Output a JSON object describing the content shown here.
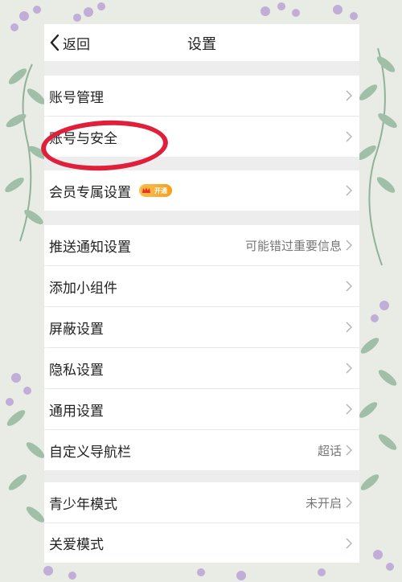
{
  "nav": {
    "back_label": "返回",
    "title": "设置"
  },
  "rows": [
    {
      "label": "账号管理",
      "value": ""
    },
    {
      "label": "账号与安全",
      "value": ""
    },
    {
      "label": "会员专属设置",
      "value": "",
      "badge": "开通"
    },
    {
      "label": "推送通知设置",
      "value": "可能错过重要信息"
    },
    {
      "label": "添加小组件",
      "value": ""
    },
    {
      "label": "屏蔽设置",
      "value": ""
    },
    {
      "label": "隐私设置",
      "value": ""
    },
    {
      "label": "通用设置",
      "value": ""
    },
    {
      "label": "自定义导航栏",
      "value": "超话"
    },
    {
      "label": "青少年模式",
      "value": "未开启"
    },
    {
      "label": "关爱模式",
      "value": ""
    }
  ],
  "colors": {
    "annotation_ring": "#e01f3a",
    "badge": "#f59f1a",
    "background_leaf": "#8fb59a",
    "background_flower": "#b9a3d6"
  },
  "icons": {
    "back": "chevron-left-icon",
    "row_arrow": "chevron-right-icon",
    "badge": "crown-icon"
  }
}
